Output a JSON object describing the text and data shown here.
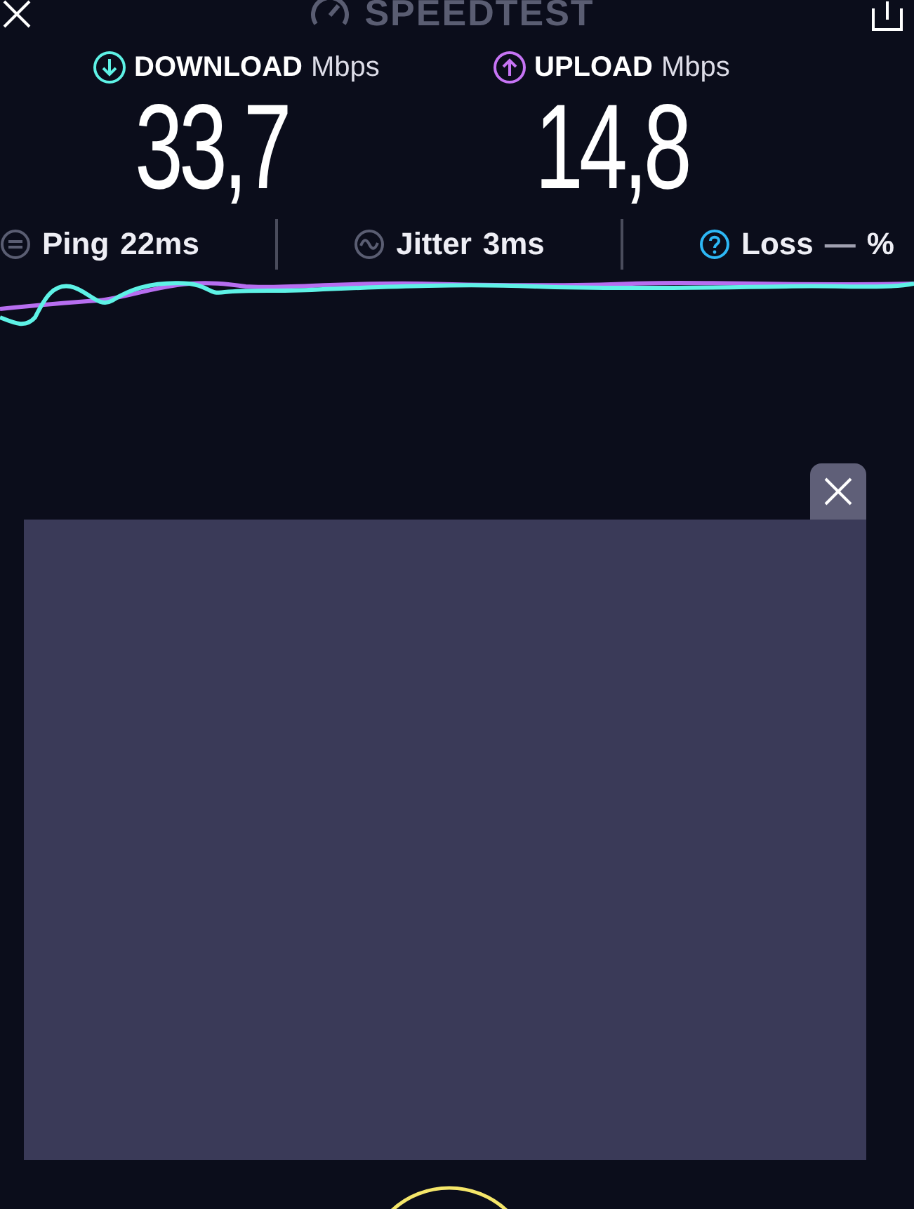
{
  "header": {
    "title": "SPEEDTEST"
  },
  "speeds": [
    {
      "kind": "download",
      "label": "DOWNLOAD",
      "unit": "Mbps",
      "value": "33,7",
      "color": "#5ef2e6"
    },
    {
      "kind": "upload",
      "label": "UPLOAD",
      "unit": "Mbps",
      "value": "14,8",
      "color": "#c774f5"
    }
  ],
  "stats": [
    {
      "kind": "ping",
      "label": "Ping",
      "value": "22ms"
    },
    {
      "kind": "jitter",
      "label": "Jitter",
      "value": "3ms"
    },
    {
      "kind": "loss",
      "label": "Loss",
      "value": "—",
      "unit": "%"
    }
  ]
}
